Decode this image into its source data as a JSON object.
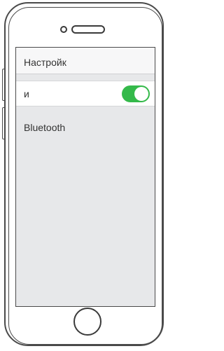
{
  "header": {
    "title": "Настройк"
  },
  "toggle_row": {
    "label": "и",
    "state": "on",
    "color": "#34b94a"
  },
  "section": {
    "label": "Bluetooth"
  },
  "icons": {
    "camera": "camera-icon",
    "speaker": "speaker-icon",
    "home": "home-button-icon"
  }
}
